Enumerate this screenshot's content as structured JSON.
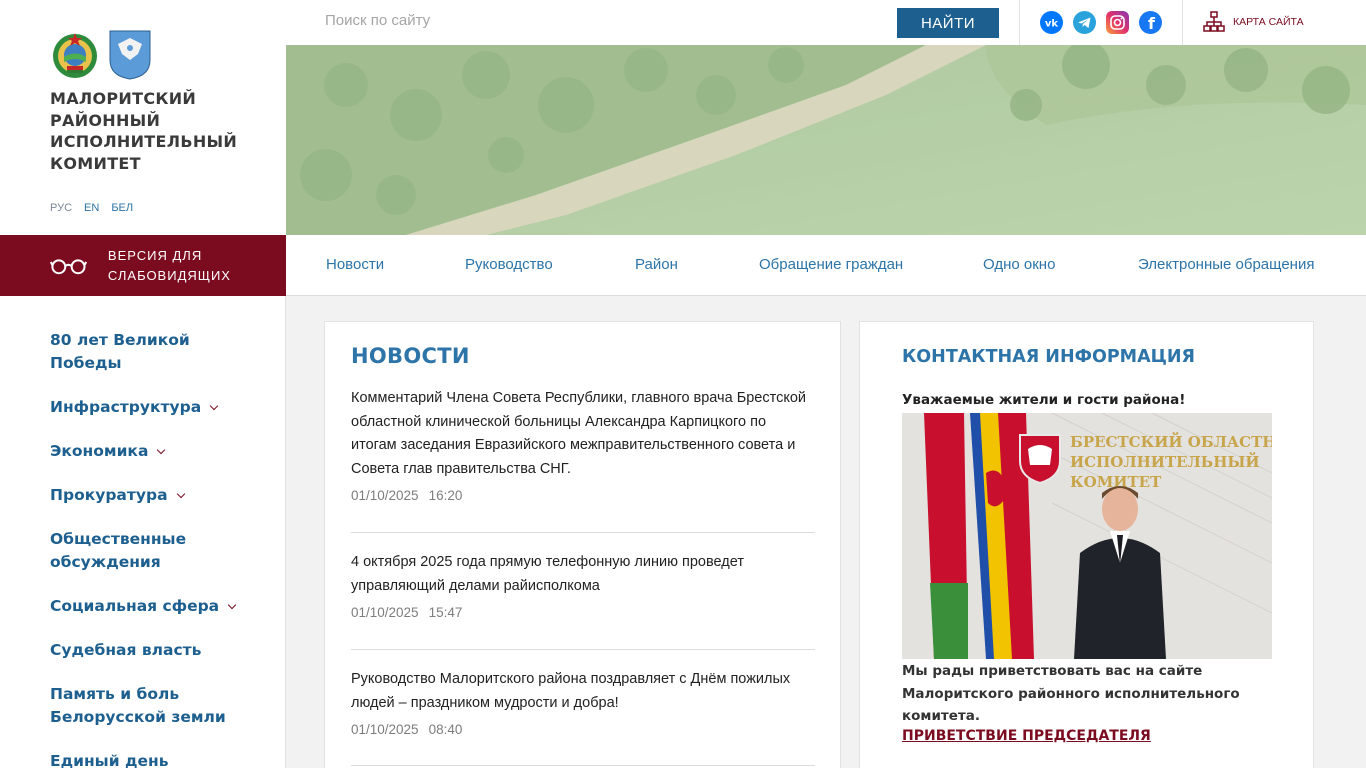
{
  "organization": {
    "name": "МАЛОРИТСКИЙ РАЙОННЫЙ ИСПОЛНИТЕЛЬНЫЙ КОМИТЕТ"
  },
  "languages": [
    {
      "label": "РУС",
      "active": true
    },
    {
      "label": "EN",
      "active": false
    },
    {
      "label": "БЕЛ",
      "active": false
    }
  ],
  "low_vision": {
    "label": "ВЕРСИЯ ДЛЯ СЛАБОВИДЯЩИХ"
  },
  "search": {
    "placeholder": "Поиск по сайту",
    "button_label": "НАЙТИ"
  },
  "social_icons": [
    "vk-icon",
    "telegram-icon",
    "instagram-icon",
    "facebook-icon"
  ],
  "sitemap": {
    "label": "КАРТА САЙТА"
  },
  "top_nav": [
    "Новости",
    "Руководство",
    "Район",
    "Обращение граждан",
    "Одно окно",
    "Электронные обращения"
  ],
  "sidebar": {
    "items": [
      {
        "label": "80 лет Великой Победы",
        "has_submenu": false
      },
      {
        "label": "Инфраструктура",
        "has_submenu": true
      },
      {
        "label": "Экономика",
        "has_submenu": true
      },
      {
        "label": "Прокуратура",
        "has_submenu": true
      },
      {
        "label": "Общественные обсуждения",
        "has_submenu": false
      },
      {
        "label": "Социальная сфера",
        "has_submenu": true
      },
      {
        "label": "Судебная власть",
        "has_submenu": false
      },
      {
        "label": "Память и боль Белорусской земли",
        "has_submenu": false
      },
      {
        "label": "Единый день информирования",
        "has_submenu": false
      }
    ]
  },
  "news": {
    "heading": "НОВОСТИ",
    "items": [
      {
        "title": "Комментарий Члена Совета Республики, главного врача Брестской областной клинической больницы Александра Карпицкого по итогам заседания Евразийского межправительственного совета и Совета глав правительства СНГ.",
        "date": "01/10/2025",
        "time": "16:20"
      },
      {
        "title": "4 октября 2025 года прямую телефонную линию проведет управляющий делами райисполкома",
        "date": "01/10/2025",
        "time": "15:47"
      },
      {
        "title": "Руководство Малоритского района поздравляет с Днём пожилых людей – праздником мудрости и добра!",
        "date": "01/10/2025",
        "time": "08:40"
      }
    ]
  },
  "contact": {
    "heading": "КОНТАКТНАЯ ИНФОРМАЦИЯ",
    "greeting": "Уважаемые жители и гости района!",
    "photo_sign": "БРЕСТСКИЙ ОБЛАСТНОЙ ИСПОЛНИТЕЛЬНЫЙ КОМИТЕТ",
    "welcome": "Мы рады приветствовать вас на сайте Малоритского районного исполнительного комитета.",
    "link_label": "ПРИВЕТСТВИЕ ПРЕДСЕДАТЕЛЯ"
  },
  "colors": {
    "primary_blue": "#1d5f8f",
    "link_blue": "#2d74a8",
    "accent_maroon": "#7b0c20"
  }
}
